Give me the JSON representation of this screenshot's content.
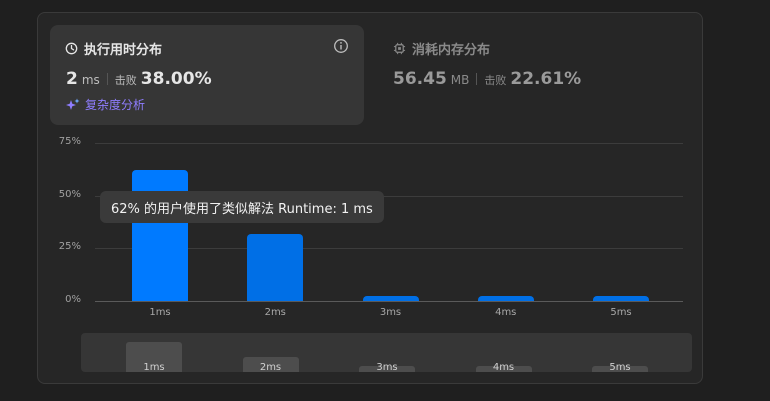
{
  "runtime": {
    "title": "执行用时分布",
    "value": "2",
    "unit": "ms",
    "beat_label": "击败",
    "beat_pct": "38.00%",
    "complexity_link": "复杂度分析"
  },
  "memory": {
    "title": "消耗内存分布",
    "value": "56.45",
    "unit": "MB",
    "beat_label": "击败",
    "beat_pct": "22.61%"
  },
  "tooltip": {
    "text": "62% 的用户使用了类似解法 Runtime: 1 ms"
  },
  "colors": {
    "accent": "#007aff",
    "bar": "#006fe6",
    "purple": "#8f7dff"
  },
  "chart_data": {
    "type": "bar",
    "categories": [
      "1ms",
      "2ms",
      "3ms",
      "4ms",
      "5ms"
    ],
    "values": [
      62,
      32,
      2,
      2,
      2
    ],
    "highlighted_index": 0,
    "yticks": [
      "75%",
      "50%",
      "25%",
      "0%"
    ],
    "ylim": [
      0,
      75
    ],
    "grid": true,
    "xlabel": "",
    "ylabel": ""
  },
  "minimap": {
    "labels": [
      "1ms",
      "2ms",
      "3ms",
      "4ms",
      "5ms"
    ]
  }
}
